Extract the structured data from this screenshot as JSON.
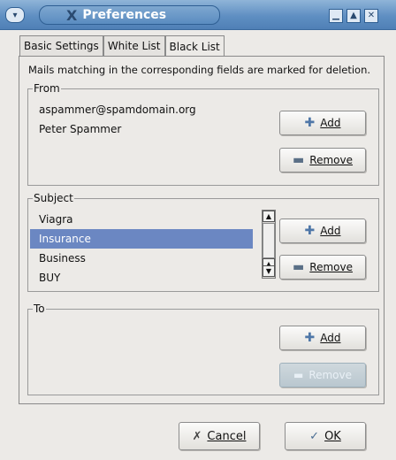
{
  "window": {
    "title": "Preferences",
    "app_glyph": "X"
  },
  "tabs": [
    {
      "label": "Basic Settings"
    },
    {
      "label": "White List"
    },
    {
      "label": "Black List",
      "active": true
    }
  ],
  "description": "Mails matching in the corresponding fields are marked for deletion.",
  "from": {
    "label": "From",
    "items": [
      "aspammer@spamdomain.org",
      "Peter Spammer"
    ],
    "add_label": "Add",
    "remove_label": "Remove"
  },
  "subject": {
    "label": "Subject",
    "items": [
      "Viagra",
      "Insurance",
      "Business",
      "BUY"
    ],
    "selected_index": 1,
    "add_label": "Add",
    "remove_label": "Remove"
  },
  "to": {
    "label": "To",
    "items": [],
    "add_label": "Add",
    "remove_label": "Remove"
  },
  "footer": {
    "cancel_label": "Cancel",
    "ok_label": "OK"
  },
  "colors": {
    "titlebar": "#5f8fc2",
    "selection": "#6b87c2"
  }
}
